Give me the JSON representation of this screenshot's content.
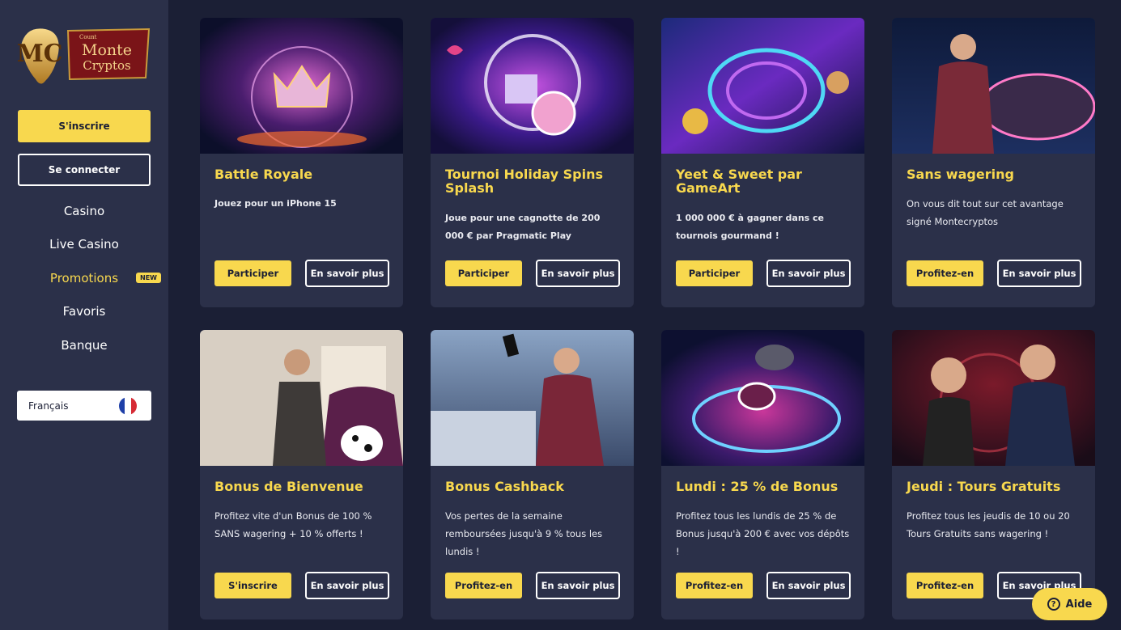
{
  "sidebar": {
    "logo": {
      "small": "Count",
      "line1": "Monte",
      "line2": "Cryptos",
      "monogram": "MC"
    },
    "signup_label": "S'inscrire",
    "login_label": "Se connecter",
    "nav": [
      {
        "label": "Casino"
      },
      {
        "label": "Live Casino"
      },
      {
        "label": "Promotions",
        "badge": "NEW"
      },
      {
        "label": "Favoris"
      },
      {
        "label": "Banque"
      }
    ],
    "language": {
      "label": "Français",
      "icon": "france-flag-icon"
    }
  },
  "cards": [
    {
      "title": "Battle Royale",
      "description": "Jouez pour un iPhone 15",
      "primary": "Participer",
      "secondary": "En savoir plus"
    },
    {
      "title": "Tournoi Holiday Spins Splash",
      "description": "Joue pour une cagnotte de 200 000 € par Pragmatic Play",
      "primary": "Participer",
      "secondary": "En savoir plus"
    },
    {
      "title": "Yeet & Sweet par GameArt",
      "description": "1 000 000 € à gagner dans ce tournois gourmand !",
      "primary": "Participer",
      "secondary": "En savoir plus"
    },
    {
      "title": "Sans wagering",
      "description": "On vous dit tout sur cet avantage signé Montecryptos",
      "primary": "Profitez-en",
      "secondary": "En savoir plus"
    },
    {
      "title": "Bonus de Bienvenue",
      "description": "Profitez vite d'un Bonus de 100 % SANS wagering + 10 % offerts !",
      "primary": "S'inscrire",
      "secondary": "En savoir plus"
    },
    {
      "title": "Bonus Cashback",
      "description": "Vos pertes de la semaine remboursées jusqu'à 9 % tous les lundis !",
      "primary": "Profitez-en",
      "secondary": "En savoir plus"
    },
    {
      "title": "Lundi : 25 % de Bonus",
      "description": "Profitez tous les lundis de 25 % de Bonus jusqu'à 200 € avec vos dépôts !",
      "primary": "Profitez-en",
      "secondary": "En savoir plus"
    },
    {
      "title": "Jeudi : Tours Gratuits",
      "description": "Profitez tous les jeudis de 10 ou 20 Tours Gratuits sans wagering !",
      "primary": "Profitez-en",
      "secondary": "En savoir plus"
    }
  ],
  "help": {
    "label": "Aide",
    "icon": "question-circle-icon"
  },
  "colors": {
    "accent": "#f8d84e",
    "background": "#1b1f35",
    "panel": "#2b3049"
  }
}
